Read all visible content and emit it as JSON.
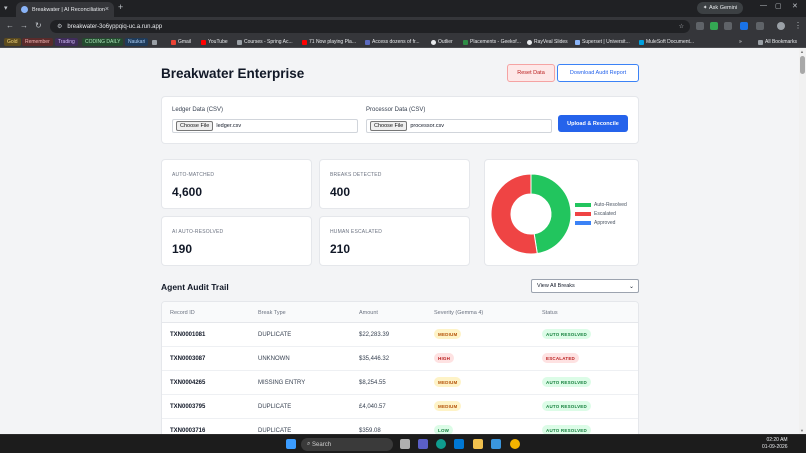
{
  "browser": {
    "tab_title": "Breakwater | AI Reconciliation",
    "url": "breakwater-3o6yppqiq-uc.a.run.app",
    "gemini_label": "Ask Gemini",
    "bookmarks": [
      "Gold",
      "Remember",
      "Trading",
      "CODING DAILY",
      "Naukari",
      "Gmail",
      "YouTube",
      "Courses - Spring Ac...",
      "71 Now playing Pla...",
      "Access dozens of fr...",
      "Outlier",
      "Placements - Geekof...",
      "RayVeal Slides",
      "Superset | Universit...",
      "MuleSoft Document..."
    ],
    "all_bookmarks": "All Bookmarks"
  },
  "header": {
    "title": "Breakwater Enterprise",
    "reset_label": "Reset Data",
    "download_label": "Download Audit Report"
  },
  "upload": {
    "ledger_label": "Ledger Data (CSV)",
    "ledger_choose": "Choose File",
    "ledger_file": "ledger.csv",
    "processor_label": "Processor Data (CSV)",
    "processor_choose": "Choose File",
    "processor_file": "processor.csv",
    "submit_label": "Upload & Reconcile"
  },
  "stats": [
    {
      "label": "AUTO-MATCHED",
      "value": "4,600"
    },
    {
      "label": "BREAKS DETECTED",
      "value": "400"
    },
    {
      "label": "AI AUTO-RESOLVED",
      "value": "190"
    },
    {
      "label": "HUMAN ESCALATED",
      "value": "210"
    }
  ],
  "chart_data": {
    "type": "pie",
    "variant": "doughnut",
    "legend_position": "right",
    "series": [
      {
        "name": "Auto-Resolved",
        "value": 190,
        "color": "#22c55e"
      },
      {
        "name": "Escalated",
        "value": 210,
        "color": "#ef4444"
      },
      {
        "name": "Approved",
        "value": 0,
        "color": "#3b82f6"
      }
    ]
  },
  "audit": {
    "title": "Agent Audit Trail",
    "filter_value": "View All Breaks",
    "columns": [
      "Record ID",
      "Break Type",
      "Amount",
      "Severity (Gemma 4)",
      "Status"
    ],
    "rows": [
      {
        "id": "TXN0001081",
        "type": "DUPLICATE",
        "amount": "$22,283.39",
        "severity": "MEDIUM",
        "status": "AUTO RESOLVED"
      },
      {
        "id": "TXN0003087",
        "type": "UNKNOWN",
        "amount": "$35,446.32",
        "severity": "HIGH",
        "status": "ESCALATED"
      },
      {
        "id": "TXN0004265",
        "type": "MISSING ENTRY",
        "amount": "$8,254.55",
        "severity": "MEDIUM",
        "status": "AUTO RESOLVED"
      },
      {
        "id": "TXN0003795",
        "type": "DUPLICATE",
        "amount": "£4,040.57",
        "severity": "MEDIUM",
        "status": "AUTO RESOLVED"
      },
      {
        "id": "TXN0003716",
        "type": "DUPLICATE",
        "amount": "$359.08",
        "severity": "LOW",
        "status": "AUTO RESOLVED"
      }
    ]
  },
  "colors": {
    "primary": "#2563eb",
    "success": "#22c55e",
    "danger": "#ef4444",
    "medium_bg": "#fef3c7",
    "medium_fg": "#b45309",
    "high_bg": "#fee2e2",
    "high_fg": "#b91c1c",
    "low_bg": "#dcfce7",
    "low_fg": "#15803d"
  },
  "taskbar": {
    "search_placeholder": "Search",
    "time": "02:20 AM",
    "date": "01-09-2026"
  }
}
